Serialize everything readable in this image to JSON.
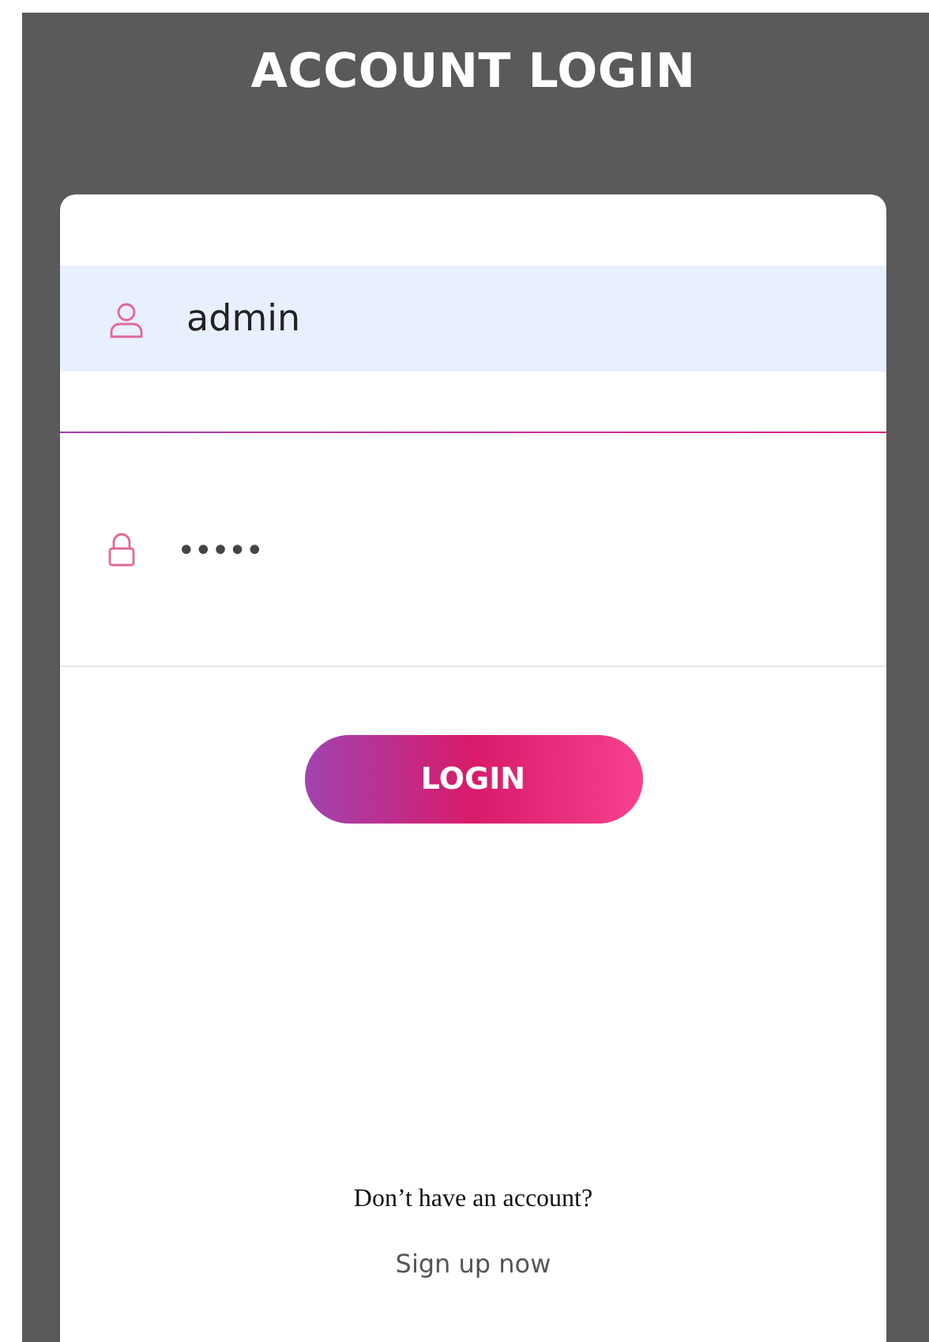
{
  "title": "ACCOUNT LOGIN",
  "username": {
    "value": "admin"
  },
  "password": {
    "value": "•••••"
  },
  "login_button": "LOGIN",
  "signup_prompt": "Don’t have an account?",
  "signup_link": "Sign up now"
}
